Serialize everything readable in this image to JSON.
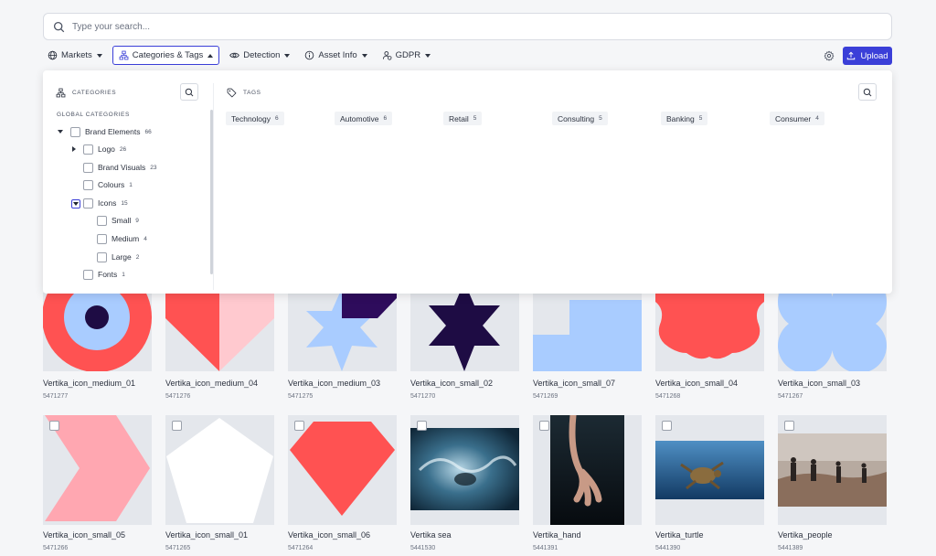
{
  "search": {
    "placeholder": "Type your search..."
  },
  "toolbar": {
    "filters": [
      {
        "label": "Markets",
        "icon": "globe-icon"
      },
      {
        "label": "Categories & Tags",
        "icon": "hierarchy-icon",
        "active": true
      },
      {
        "label": "Detection",
        "icon": "eye-icon"
      },
      {
        "label": "Asset Info",
        "icon": "info-icon"
      },
      {
        "label": "GDPR",
        "icon": "user-shield-icon"
      }
    ],
    "upload_label": "Upload"
  },
  "categories_panel": {
    "heading": "CATEGORIES",
    "section_label": "GLOBAL CATEGORIES",
    "items": [
      {
        "label": "Brand Elements",
        "count": "66"
      },
      {
        "label": "Logo",
        "count": "26"
      },
      {
        "label": "Brand Visuals",
        "count": "23"
      },
      {
        "label": "Colours",
        "count": "1"
      },
      {
        "label": "Icons",
        "count": "15"
      },
      {
        "label": "Small",
        "count": "9"
      },
      {
        "label": "Medium",
        "count": "4"
      },
      {
        "label": "Large",
        "count": "2"
      },
      {
        "label": "Fonts",
        "count": "1"
      }
    ]
  },
  "tags_panel": {
    "heading": "TAGS",
    "tags": [
      {
        "label": "Technology",
        "count": "6"
      },
      {
        "label": "Automotive",
        "count": "6"
      },
      {
        "label": "Retail",
        "count": "5"
      },
      {
        "label": "Consulting",
        "count": "5"
      },
      {
        "label": "Banking",
        "count": "5"
      },
      {
        "label": "Consumer",
        "count": "4"
      }
    ]
  },
  "assets": [
    {
      "name": "Vertika_icon_medium_01",
      "id": "5471277"
    },
    {
      "name": "Vertika_icon_medium_04",
      "id": "5471276"
    },
    {
      "name": "Vertika_icon_medium_03",
      "id": "5471275"
    },
    {
      "name": "Vertika_icon_small_02",
      "id": "5471270"
    },
    {
      "name": "Vertika_icon_small_07",
      "id": "5471269"
    },
    {
      "name": "Vertika_icon_small_04",
      "id": "5471268"
    },
    {
      "name": "Vertika_icon_small_03",
      "id": "5471267"
    },
    {
      "name": "Vertika_icon_small_05",
      "id": "5471266"
    },
    {
      "name": "Vertika_icon_small_01",
      "id": "5471265"
    },
    {
      "name": "Vertika_icon_small_06",
      "id": "5471264"
    },
    {
      "name": "Vertika sea",
      "id": "5441530"
    },
    {
      "name": "Vertika_hand",
      "id": "5441391"
    },
    {
      "name": "Vertika_turtle",
      "id": "5441390"
    },
    {
      "name": "Vertika_people",
      "id": "5441389"
    }
  ],
  "colors": {
    "accent": "#3b3fd8",
    "coral": "#ff5252",
    "pink": "#ffa7b1",
    "light_blue": "#a9ccff",
    "navy": "#1e0c44"
  }
}
